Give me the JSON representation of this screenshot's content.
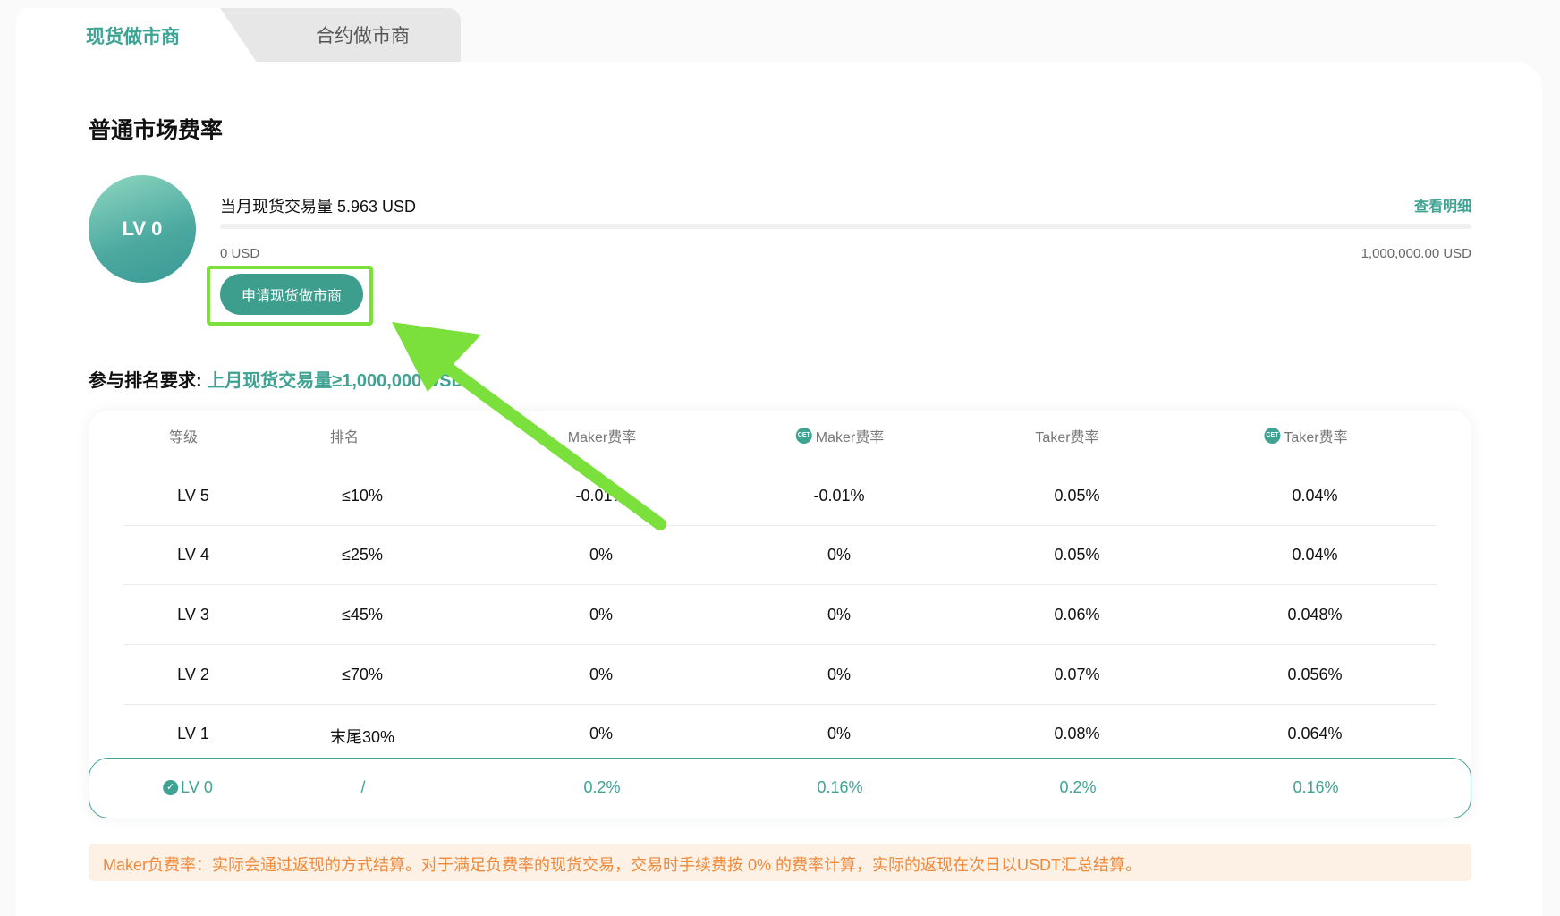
{
  "tabs": {
    "spot": "现货做市商",
    "contract": "合约做市商"
  },
  "section_title": "普通市场费率",
  "level": {
    "badge": "LV 0",
    "volume_text": "当月现货交易量 5.963 USD",
    "detail_link": "查看明细",
    "progress_fraction": 6e-06,
    "range_min": "0 USD",
    "range_max": "1,000,000.00 USD"
  },
  "apply_button": "申请现货做市商",
  "rank_requirement": {
    "label": "参与排名要求:",
    "value": "上月现货交易量≥1,000,000 USD"
  },
  "table": {
    "headers": {
      "level": "等级",
      "rank": "排名",
      "maker": "Maker费率",
      "cet_maker": "Maker费率",
      "taker": "Taker费率",
      "cet_taker": "Taker费率",
      "cet_icon_text": "CET"
    },
    "rows": [
      {
        "level": "LV 5",
        "rank": "≤10%",
        "maker": "-0.01%",
        "cet_maker": "-0.01%",
        "taker": "0.05%",
        "cet_taker": "0.04%"
      },
      {
        "level": "LV 4",
        "rank": "≤25%",
        "maker": "0%",
        "cet_maker": "0%",
        "taker": "0.05%",
        "cet_taker": "0.04%"
      },
      {
        "level": "LV 3",
        "rank": "≤45%",
        "maker": "0%",
        "cet_maker": "0%",
        "taker": "0.06%",
        "cet_taker": "0.048%"
      },
      {
        "level": "LV 2",
        "rank": "≤70%",
        "maker": "0%",
        "cet_maker": "0%",
        "taker": "0.07%",
        "cet_taker": "0.056%"
      },
      {
        "level": "LV 1",
        "rank": "末尾30%",
        "maker": "0%",
        "cet_maker": "0%",
        "taker": "0.08%",
        "cet_taker": "0.064%"
      }
    ],
    "current_row": {
      "level": "LV 0",
      "rank": "/",
      "maker": "0.2%",
      "cet_maker": "0.16%",
      "taker": "0.2%",
      "cet_taker": "0.16%"
    }
  },
  "notice": "Maker负费率：实际会通过返现的方式结算。对于满足负费率的现货交易，交易时手续费按 0% 的费率计算，实际的返现在次日以USDT汇总结算。",
  "colors": {
    "accent": "#3ea393",
    "highlight": "#7be03c",
    "notice_text": "#f0893a",
    "notice_bg": "#fdf1e6"
  }
}
